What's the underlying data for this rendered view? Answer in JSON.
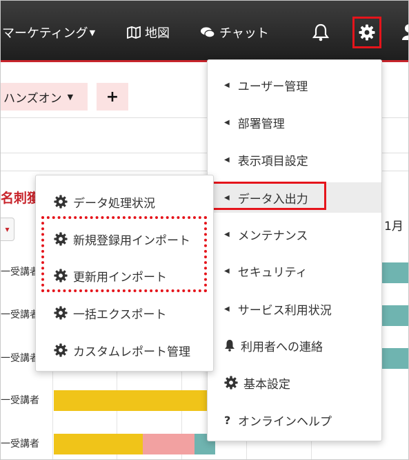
{
  "navbar": {
    "marketing_label": "マーケティング",
    "map_label": "地図",
    "chat_label": "チャット",
    "icons": {
      "map": "map-icon",
      "chat": "chat-icon",
      "bell": "bell-icon",
      "gear": "gear-icon",
      "user": "user-icon"
    }
  },
  "toolbar": {
    "tab_label": "ハンズオン",
    "add_label": "+"
  },
  "background": {
    "title_fragment": "名刺獲",
    "month_label": "1月",
    "row_labels": [
      "一受講者",
      "一受講者",
      "一受講者",
      "一受講者",
      "一受講者"
    ]
  },
  "settings_menu": {
    "items": [
      {
        "label": "ユーザー管理",
        "icon": "caret-left-icon"
      },
      {
        "label": "部署管理",
        "icon": "caret-left-icon"
      },
      {
        "label": "表示項目設定",
        "icon": "caret-left-icon"
      },
      {
        "label": "データ入出力",
        "icon": "caret-left-icon"
      },
      {
        "label": "メンテナンス",
        "icon": "caret-left-icon"
      },
      {
        "label": "セキュリティ",
        "icon": "caret-left-icon"
      },
      {
        "label": "サービス利用状況",
        "icon": "caret-left-icon"
      },
      {
        "label": "利用者への連絡",
        "icon": "bell-icon"
      },
      {
        "label": "基本設定",
        "icon": "gear-icon"
      },
      {
        "label": "オンラインヘルプ",
        "icon": "question-icon"
      }
    ]
  },
  "data_menu": {
    "items": [
      {
        "label": "データ処理状況",
        "icon": "gear-icon"
      },
      {
        "label": "新規登録用インポート",
        "icon": "gear-icon"
      },
      {
        "label": "更新用インポート",
        "icon": "gear-icon"
      },
      {
        "label": "一括エクスポート",
        "icon": "gear-icon"
      },
      {
        "label": "カスタムレポート管理",
        "icon": "gear-icon"
      }
    ]
  },
  "colors": {
    "navbar_accent": "#c8252c",
    "highlight_red": "#e5141b",
    "tab_bg": "#fbe2e2",
    "bar_yellow": "#f0c419",
    "bar_pink": "#f2a1a1",
    "bar_teal": "#6fb4b0"
  }
}
